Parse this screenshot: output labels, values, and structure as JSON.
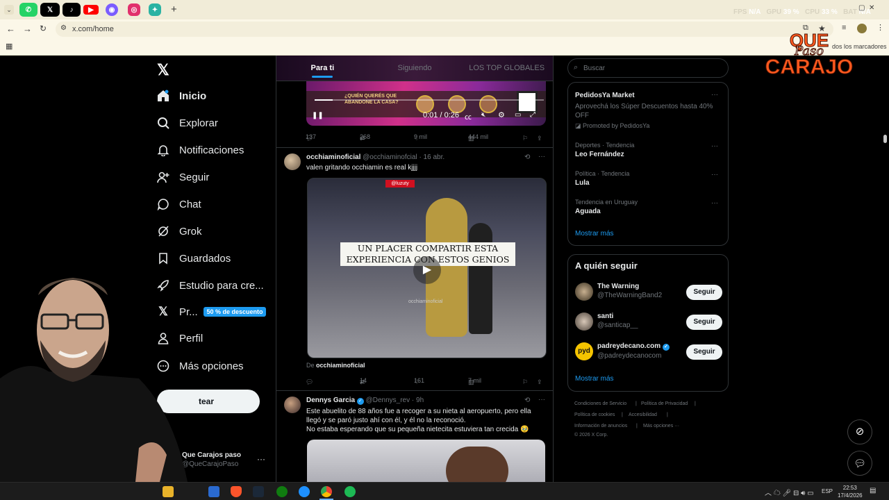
{
  "browser": {
    "url": "x.com/home",
    "bookmarks_label": "dos los marcadores",
    "perf": {
      "fps_label": "FPS",
      "fps": "N/A",
      "gpu_label": "GPU",
      "gpu": "39 %",
      "cpu_label": "CPU",
      "cpu": "33 %",
      "bat_label": "BAT",
      "bat": "N/A"
    },
    "tabs": [
      {
        "icon": "whatsapp-icon",
        "color": "#25d366"
      },
      {
        "icon": "x-icon",
        "color": "#000000"
      },
      {
        "icon": "tiktok-icon",
        "color": "#000000"
      },
      {
        "icon": "youtube-icon",
        "color": "#ff0000"
      },
      {
        "icon": "browser-icon",
        "color": "#7a5cff"
      },
      {
        "icon": "instagram-icon",
        "color": "#e1306c"
      },
      {
        "icon": "app-icon",
        "color": "#2bb3a3"
      }
    ]
  },
  "overlay_logo": {
    "line1": "QUE",
    "line2": "Paso",
    "line3": "CARAJO"
  },
  "sidebar": {
    "items": [
      {
        "label": "Inicio",
        "icon": "home-icon"
      },
      {
        "label": "Explorar",
        "icon": "search-icon"
      },
      {
        "label": "Notificaciones",
        "icon": "bell-icon"
      },
      {
        "label": "Seguir",
        "icon": "add-user-icon"
      },
      {
        "label": "Chat",
        "icon": "chat-icon"
      },
      {
        "label": "Grok",
        "icon": "grok-icon"
      },
      {
        "label": "Guardados",
        "icon": "bookmark-icon"
      },
      {
        "label": "Estudio para cre...",
        "icon": "rocket-icon"
      },
      {
        "label": "Pr...",
        "icon": "x-icon"
      },
      {
        "label": "Perfil",
        "icon": "person-icon"
      },
      {
        "label": "Más opciones",
        "icon": "more-circle-icon"
      }
    ],
    "premium_badge": "50 % de descuento",
    "post_button": "Postear",
    "post_button_visible": "tear",
    "account": {
      "name": "Que Carajos paso",
      "handle": "@QueCarajoPaso"
    }
  },
  "timeline": {
    "tabs": [
      "Para ti",
      "Siguiendo",
      "LOS TOP GLOBALES"
    ],
    "post1": {
      "video_text": "¿QUIÉN QUERÉS QUE ABANDONE LA CASA?",
      "video_time": "0:01 / 0:26",
      "replies": "137",
      "reposts": "268",
      "likes": "9 mil",
      "views": "444 mil"
    },
    "post2": {
      "name": "occhiaminoficial",
      "handle": "@occhiaminofcial",
      "date": "· 16 abr.",
      "text": "valen gritando occhiamin es real kjjjj",
      "video_tag": "@luzuty",
      "caption_line1": "UN PLACER COMPARTIR ESTA",
      "caption_line2": "EXPERIENCIA CON ESTOS GENIOS",
      "watermark": "occhiaminoficial",
      "from_label": "De",
      "from_name": "occhiaminoficial",
      "replies": "",
      "reposts": "14",
      "likes": "161",
      "views": "7 mil"
    },
    "post3": {
      "name": "Dennys Garcia",
      "handle": "@Dennys_rev",
      "date": "· 9h",
      "text_line1": "Este abuelito de 88 años fue a recoger a su nieta al aeropuerto, pero ella",
      "text_line2": "llegó y se paró justo ahí con él, y él no la reconoció.",
      "text_line3": "No estaba esperando que su pequeña nietecita estuviera tan crecida 🥹"
    }
  },
  "right": {
    "search_placeholder": "Buscar",
    "trends": {
      "ad_title": "PedidosYa Market",
      "ad_text_line1": "Aprovechá los Súper Descuentos hasta 40%",
      "ad_text_line2": "OFF",
      "ad_promoted": "Promoted by PedidosYa",
      "items": [
        {
          "context": "Deportes · Tendencia",
          "name": "Leo Fernández"
        },
        {
          "context": "Política · Tendencia",
          "name": "Lula"
        },
        {
          "context": "Tendencia en Uruguay",
          "name": "Aguada"
        }
      ],
      "show_more": "Mostrar más"
    },
    "follow": {
      "title": "A quién seguir",
      "users": [
        {
          "name": "The Warning",
          "handle": "@TheWarningBand2",
          "button": "Seguir"
        },
        {
          "name": "santi",
          "handle": "@santicap__",
          "button": "Seguir"
        },
        {
          "name": "padreydecano.com",
          "handle": "@padreydecanocom",
          "button": "Seguir"
        }
      ],
      "pyd_logo": "pyd",
      "show_more": "Mostrar más"
    },
    "footer": {
      "l1": "Condiciones de Servicio",
      "l2": "Política de Privacidad",
      "l3": "Política de cookies",
      "l4": "Accesibilidad",
      "l5": "Información de anuncios",
      "l6": "Más opciones ···",
      "copyright": "© 2026 X Corp."
    }
  },
  "taskbar": {
    "lang": "ESP",
    "time": "22:53",
    "date": "17/4/2026"
  }
}
